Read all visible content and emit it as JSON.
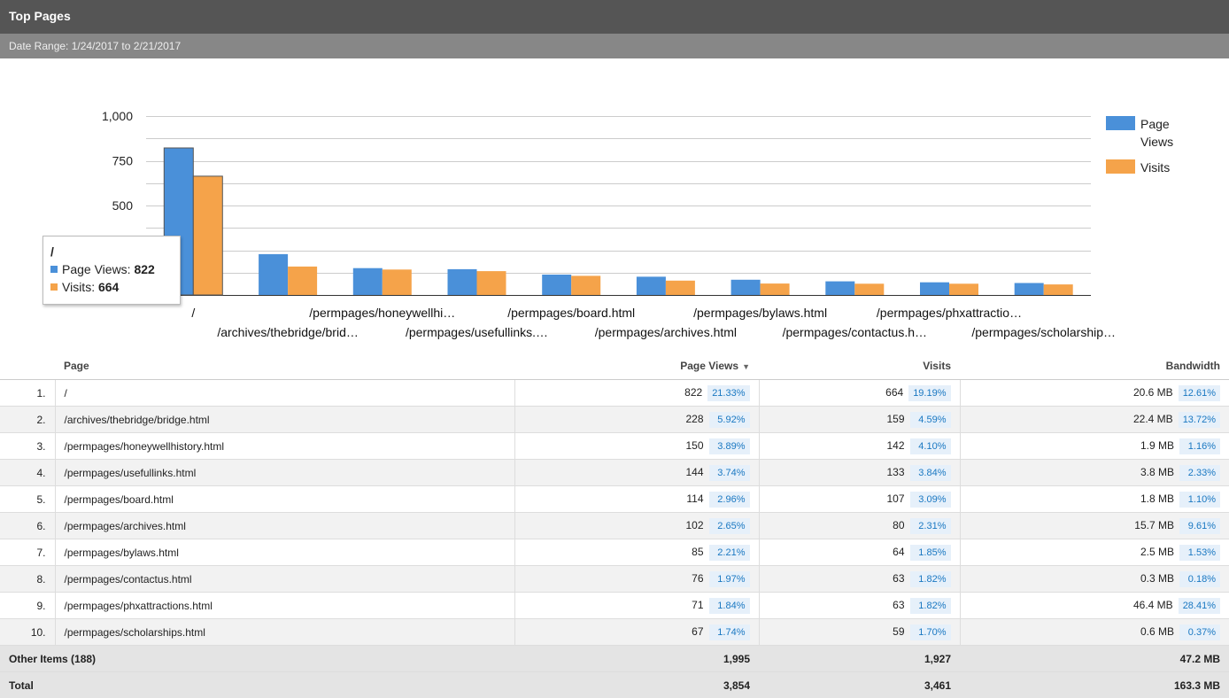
{
  "header": {
    "title": "Top Pages",
    "date_range": "Date Range: 1/24/2017 to 2/21/2017"
  },
  "colors": {
    "page_views": "#4a90d9",
    "visits": "#f5a34a",
    "header_bg": "#555555",
    "subheader_bg": "#878787",
    "pct_text": "#1a78c2"
  },
  "chart_data": {
    "type": "bar",
    "categories": [
      "/",
      "/archives/thebridge/brid…",
      "/permpages/honeywellhi…",
      "/permpages/usefullinks.…",
      "/permpages/board.html",
      "/permpages/archives.html",
      "/permpages/bylaws.html",
      "/permpages/contactus.h…",
      "/permpages/phxattractio…",
      "/permpages/scholarship…"
    ],
    "series": [
      {
        "name": "Page Views",
        "values": [
          822,
          228,
          150,
          144,
          114,
          102,
          85,
          76,
          71,
          67
        ]
      },
      {
        "name": "Visits",
        "values": [
          664,
          159,
          142,
          133,
          107,
          80,
          64,
          63,
          63,
          59
        ]
      }
    ],
    "yticks": [
      "500",
      "750",
      "1,000"
    ],
    "ylim": [
      0,
      1000
    ],
    "legend_position": "right",
    "grid": true
  },
  "legend": {
    "page_views": "Page Views",
    "visits": "Visits"
  },
  "tooltip": {
    "title": "/",
    "pv_label": "Page Views: ",
    "pv_value": "822",
    "visits_label": "Visits: ",
    "visits_value": "664"
  },
  "table": {
    "columns": {
      "page": "Page",
      "page_views": "Page Views",
      "visits": "Visits",
      "bandwidth": "Bandwidth"
    },
    "rows": [
      {
        "rank": "1.",
        "page": "/",
        "pv": "822",
        "pv_pct": "21.33%",
        "visits": "664",
        "visits_pct": "19.19%",
        "bw": "20.6 MB",
        "bw_pct": "12.61%"
      },
      {
        "rank": "2.",
        "page": "/archives/thebridge/bridge.html",
        "pv": "228",
        "pv_pct": "5.92%",
        "visits": "159",
        "visits_pct": "4.59%",
        "bw": "22.4 MB",
        "bw_pct": "13.72%"
      },
      {
        "rank": "3.",
        "page": "/permpages/honeywellhistory.html",
        "pv": "150",
        "pv_pct": "3.89%",
        "visits": "142",
        "visits_pct": "4.10%",
        "bw": "1.9 MB",
        "bw_pct": "1.16%"
      },
      {
        "rank": "4.",
        "page": "/permpages/usefullinks.html",
        "pv": "144",
        "pv_pct": "3.74%",
        "visits": "133",
        "visits_pct": "3.84%",
        "bw": "3.8 MB",
        "bw_pct": "2.33%"
      },
      {
        "rank": "5.",
        "page": "/permpages/board.html",
        "pv": "114",
        "pv_pct": "2.96%",
        "visits": "107",
        "visits_pct": "3.09%",
        "bw": "1.8 MB",
        "bw_pct": "1.10%"
      },
      {
        "rank": "6.",
        "page": "/permpages/archives.html",
        "pv": "102",
        "pv_pct": "2.65%",
        "visits": "80",
        "visits_pct": "2.31%",
        "bw": "15.7 MB",
        "bw_pct": "9.61%"
      },
      {
        "rank": "7.",
        "page": "/permpages/bylaws.html",
        "pv": "85",
        "pv_pct": "2.21%",
        "visits": "64",
        "visits_pct": "1.85%",
        "bw": "2.5 MB",
        "bw_pct": "1.53%"
      },
      {
        "rank": "8.",
        "page": "/permpages/contactus.html",
        "pv": "76",
        "pv_pct": "1.97%",
        "visits": "63",
        "visits_pct": "1.82%",
        "bw": "0.3 MB",
        "bw_pct": "0.18%"
      },
      {
        "rank": "9.",
        "page": "/permpages/phxattractions.html",
        "pv": "71",
        "pv_pct": "1.84%",
        "visits": "63",
        "visits_pct": "1.82%",
        "bw": "46.4 MB",
        "bw_pct": "28.41%"
      },
      {
        "rank": "10.",
        "page": "/permpages/scholarships.html",
        "pv": "67",
        "pv_pct": "1.74%",
        "visits": "59",
        "visits_pct": "1.70%",
        "bw": "0.6 MB",
        "bw_pct": "0.37%"
      }
    ],
    "other": {
      "label": "Other Items (188)",
      "pv": "1,995",
      "visits": "1,927",
      "bw": "47.2 MB"
    },
    "total": {
      "label": "Total",
      "pv": "3,854",
      "visits": "3,461",
      "bw": "163.3 MB"
    }
  }
}
